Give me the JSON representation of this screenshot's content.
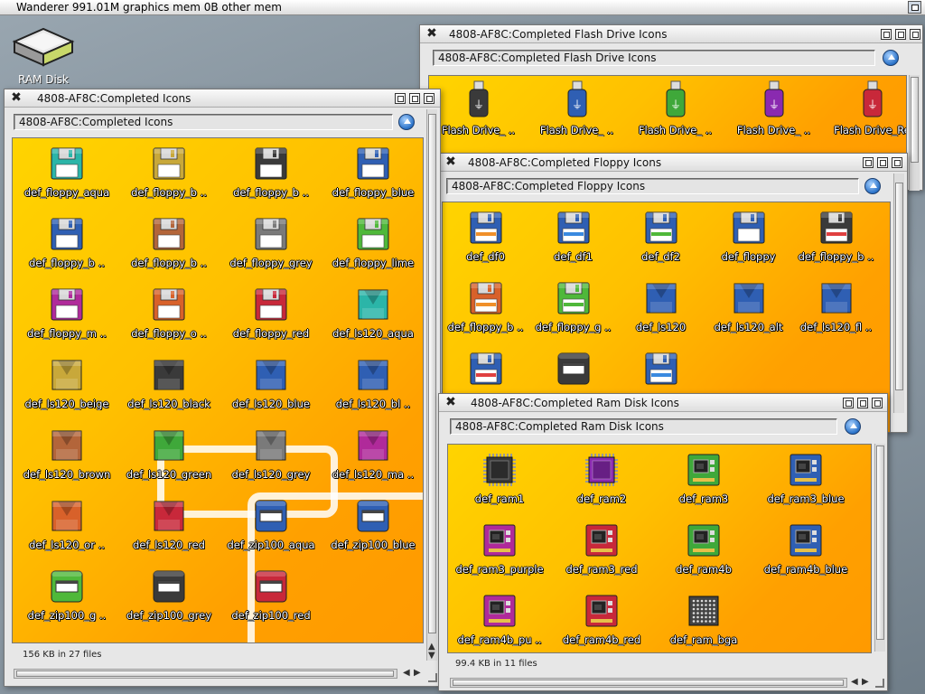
{
  "screen": {
    "title": "Wanderer 991.01M graphics mem 0B other mem"
  },
  "desktop": {
    "ramdisk_label": "RAM Disk"
  },
  "colors": {
    "aqua": "#2bb5a8",
    "beige": "#c8a83a",
    "black": "#3a3a3a",
    "blue": "#2f5fb3",
    "brown": "#b3653a",
    "grey": "#7a7a7a",
    "lime": "#4fb83a",
    "magenta": "#b02a9a",
    "orange": "#d8612a",
    "red": "#c8283a",
    "green": "#3fa83a",
    "purple": "#8a2ab0"
  },
  "windows": {
    "main": {
      "title": "4808-AF8C:Completed Icons",
      "path": "4808-AF8C:Completed Icons",
      "status": "156 KB in 27 files",
      "icons": [
        {
          "label": "def_floppy_aqua",
          "kind": "floppy",
          "color": "aqua"
        },
        {
          "label": "def_floppy_b ..",
          "kind": "floppy",
          "color": "beige"
        },
        {
          "label": "def_floppy_b ..",
          "kind": "floppy",
          "color": "black"
        },
        {
          "label": "def_floppy_blue",
          "kind": "floppy",
          "color": "blue"
        },
        {
          "label": "def_floppy_b ..",
          "kind": "floppy",
          "color": "blue"
        },
        {
          "label": "def_floppy_b ..",
          "kind": "floppy",
          "color": "brown"
        },
        {
          "label": "def_floppy_grey",
          "kind": "floppy",
          "color": "grey"
        },
        {
          "label": "def_floppy_lime",
          "kind": "floppy",
          "color": "lime"
        },
        {
          "label": "def_floppy_m ..",
          "kind": "floppy",
          "color": "magenta"
        },
        {
          "label": "def_floppy_o ..",
          "kind": "floppy",
          "color": "orange"
        },
        {
          "label": "def_floppy_red",
          "kind": "floppy",
          "color": "red"
        },
        {
          "label": "def_ls120_aqua",
          "kind": "ls120",
          "color": "aqua"
        },
        {
          "label": "def_ls120_beige",
          "kind": "ls120",
          "color": "beige"
        },
        {
          "label": "def_ls120_black",
          "kind": "ls120",
          "color": "black"
        },
        {
          "label": "def_ls120_blue",
          "kind": "ls120",
          "color": "blue"
        },
        {
          "label": "def_ls120_bl ..",
          "kind": "ls120",
          "color": "blue"
        },
        {
          "label": "def_ls120_brown",
          "kind": "ls120",
          "color": "brown"
        },
        {
          "label": "def_ls120_green",
          "kind": "ls120",
          "color": "green"
        },
        {
          "label": "def_ls120_grey",
          "kind": "ls120",
          "color": "grey"
        },
        {
          "label": "def_ls120_ma ..",
          "kind": "ls120",
          "color": "magenta"
        },
        {
          "label": "def_ls120_or ..",
          "kind": "ls120",
          "color": "orange"
        },
        {
          "label": "def_ls120_red",
          "kind": "ls120",
          "color": "red"
        },
        {
          "label": "def_zip100_aqua",
          "kind": "zip",
          "color": "blue"
        },
        {
          "label": "def_zip100_blue",
          "kind": "zip",
          "color": "blue"
        },
        {
          "label": "def_zip100_g ..",
          "kind": "zip",
          "color": "lime"
        },
        {
          "label": "def_zip100_grey",
          "kind": "zip",
          "color": "black"
        },
        {
          "label": "def_zip100_red",
          "kind": "zip",
          "color": "red"
        }
      ]
    },
    "flash": {
      "title": "4808-AF8C:Completed Flash Drive Icons",
      "path": "4808-AF8C:Completed Flash Drive Icons",
      "icons": [
        {
          "label": "Flash Drive_ ..",
          "kind": "usb",
          "color": "black"
        },
        {
          "label": "Flash Drive_ ..",
          "kind": "usb",
          "color": "blue"
        },
        {
          "label": "Flash Drive_ ..",
          "kind": "usb",
          "color": "green"
        },
        {
          "label": "Flash Drive_ ..",
          "kind": "usb",
          "color": "purple"
        },
        {
          "label": "Flash Drive_Re",
          "kind": "usb",
          "color": "red"
        }
      ]
    },
    "floppy": {
      "title": "4808-AF8C:Completed Floppy Icons",
      "path": "4808-AF8C:Completed Floppy Icons",
      "icons": [
        {
          "label": "def_df0",
          "kind": "floppyL",
          "color": "blue",
          "stripe": "#f0902a"
        },
        {
          "label": "def_df1",
          "kind": "floppyL",
          "color": "blue",
          "stripe": "#3a8ae0"
        },
        {
          "label": "def_df2",
          "kind": "floppyL",
          "color": "blue",
          "stripe": "#4fb83a"
        },
        {
          "label": "def_floppy",
          "kind": "floppy",
          "color": "blue"
        },
        {
          "label": "def_floppy_b ..",
          "kind": "floppyL",
          "color": "black",
          "stripe": "#e04040"
        },
        {
          "label": "def_floppy_b ..",
          "kind": "floppyL",
          "color": "orange",
          "stripe": "#f0902a"
        },
        {
          "label": "def_floppy_g ..",
          "kind": "floppyL",
          "color": "lime",
          "stripe": "#4fb83a"
        },
        {
          "label": "def_ls120",
          "kind": "ls120",
          "color": "blue"
        },
        {
          "label": "def_ls120_alt",
          "kind": "ls120",
          "color": "blue"
        },
        {
          "label": "def_ls120_fl ..",
          "kind": "ls120",
          "color": "blue"
        },
        {
          "label": "",
          "kind": "floppyL",
          "color": "blue",
          "stripe": "#e04040"
        },
        {
          "label": "",
          "kind": "zip",
          "color": "black"
        },
        {
          "label": "",
          "kind": "floppyL",
          "color": "blue",
          "stripe": "#3a8ae0"
        }
      ]
    },
    "ram": {
      "title": "4808-AF8C:Completed Ram Disk Icons",
      "path": "4808-AF8C:Completed Ram Disk Icons",
      "status": "99.4 KB in 11 files",
      "icons": [
        {
          "label": "def_ram1",
          "kind": "chip",
          "color": "black"
        },
        {
          "label": "def_ram2",
          "kind": "chip",
          "color": "purple"
        },
        {
          "label": "def_ram3",
          "kind": "board",
          "color": "green"
        },
        {
          "label": "def_ram3_blue",
          "kind": "board",
          "color": "blue"
        },
        {
          "label": "def_ram3_purple",
          "kind": "board",
          "color": "magenta"
        },
        {
          "label": "def_ram3_red",
          "kind": "board",
          "color": "red"
        },
        {
          "label": "def_ram4b",
          "kind": "board",
          "color": "green"
        },
        {
          "label": "def_ram4b_blue",
          "kind": "board",
          "color": "blue"
        },
        {
          "label": "def_ram4b_pu ..",
          "kind": "board",
          "color": "magenta"
        },
        {
          "label": "def_ram4b_red",
          "kind": "board",
          "color": "red"
        },
        {
          "label": "def_ram_bga",
          "kind": "bga",
          "color": "grey"
        }
      ]
    }
  }
}
